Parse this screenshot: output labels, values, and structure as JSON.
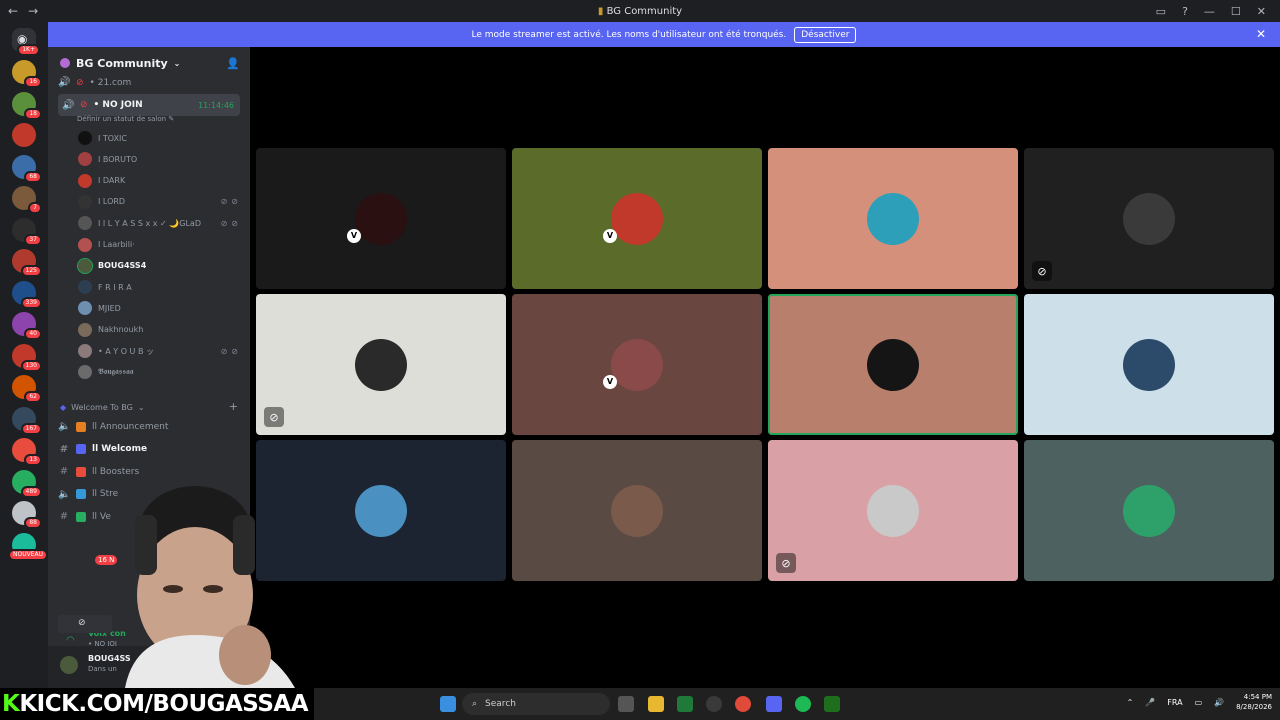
{
  "window": {
    "title": "BG Community",
    "back": "←",
    "forward": "→"
  },
  "banner": {
    "text": "Le mode streamer est activé. Les noms d'utilisateur ont été tronqués.",
    "button": "Désactiver",
    "close": "✕"
  },
  "rail": {
    "home_badge": "1K+",
    "servers": [
      {
        "badge": "16",
        "color": "#c89a2a"
      },
      {
        "badge": "18",
        "color": "#5a8f3c"
      },
      {
        "badge": "",
        "color": "#c0392b"
      },
      {
        "badge": "68",
        "color": "#3b6ea8"
      },
      {
        "badge": "7",
        "color": "#7a5a3a"
      },
      {
        "badge": "37",
        "color": "#2d2d2d"
      },
      {
        "badge": "125",
        "color": "#b03a2e"
      },
      {
        "badge": "339",
        "color": "#1f4f8a"
      },
      {
        "badge": "40",
        "color": "#8e44ad"
      },
      {
        "badge": "130",
        "color": "#c0392b"
      },
      {
        "badge": "62",
        "color": "#d35400"
      },
      {
        "badge": "167",
        "color": "#34495e"
      },
      {
        "badge": "13",
        "color": "#e74c3c"
      },
      {
        "badge": "489",
        "color": "#27ae60"
      },
      {
        "badge": "88",
        "color": "#bdc3c7"
      },
      {
        "badge": "NOUVEAU",
        "color": "#1abc9c"
      }
    ]
  },
  "sidebar": {
    "server_name": "BG Community",
    "channels_top": [
      {
        "name": "• 21.com"
      },
      {
        "name": "• NO JOIN",
        "time": "11:14:46",
        "subtitle": "Définir un statut de salon ✎"
      }
    ],
    "users": [
      {
        "name": "I TOXIC",
        "color": "#111111",
        "icons": ""
      },
      {
        "name": "I BORUTO",
        "color": "#a04040",
        "icons": ""
      },
      {
        "name": "I DARK",
        "color": "#c0392b",
        "icons": ""
      },
      {
        "name": "I LORD",
        "color": "#333333",
        "icons": "⊘⊘"
      },
      {
        "name": "I I L Y A S S x x ✓ 🌙GLaD",
        "color": "#555555",
        "icons": "⊘⊘"
      },
      {
        "name": "I Laarbili·",
        "color": "#b35050",
        "icons": ""
      },
      {
        "name": "BOUG4SS4",
        "color": "#4a5a3a",
        "icons": "",
        "me": true
      },
      {
        "name": "F R I R A",
        "color": "#2c3e50",
        "icons": ""
      },
      {
        "name": "MJIED",
        "color": "#6d8fb0",
        "icons": ""
      },
      {
        "name": "Nakhnoukh",
        "color": "#7a6a5a",
        "icons": ""
      },
      {
        "name": "• A Y O U B ッ",
        "color": "#8a7a7a",
        "icons": "⊘⊘"
      },
      {
        "name": "𝕭𝖔𝖚𝖌𝖆𝖘𝖘𝖆𝖆",
        "color": "#6b6b6b",
        "icons": ""
      }
    ],
    "category": "Welcome To BG",
    "text_channels": [
      {
        "icon": "🔈",
        "name": "ll Announcement"
      },
      {
        "icon": "#",
        "name": "ll Welcome",
        "active": true
      },
      {
        "icon": "#",
        "name": "ll Boosters"
      },
      {
        "icon": "🔈",
        "name": "ll Stre"
      },
      {
        "icon": "#",
        "name": "ll Ve"
      }
    ],
    "voice_status": {
      "title": "Voix con",
      "sub": "• NO JOI"
    },
    "user": {
      "name": "BOUG4SS",
      "status": "Dans un"
    }
  },
  "tiles": [
    {
      "bg": "#1a1a1a",
      "avatar": "#2a1010",
      "verified": true,
      "muted": false
    },
    {
      "bg": "#5b6b2a",
      "avatar": "#c0392b",
      "verified": true,
      "muted": false
    },
    {
      "bg": "#d4907a",
      "avatar": "#2e9fb8",
      "verified": false,
      "muted": false
    },
    {
      "bg": "#202020",
      "avatar": "#3a3a3a",
      "verified": false,
      "muted": true
    },
    {
      "bg": "#deded9",
      "avatar": "#2a2a2a",
      "verified": false,
      "muted": true
    },
    {
      "bg": "#6a4640",
      "avatar": "#8a4a4a",
      "verified": true,
      "muted": false
    },
    {
      "bg": "#b8806c",
      "avatar": "#151515",
      "verified": false,
      "muted": false,
      "speaking": true
    },
    {
      "bg": "#cde0ea",
      "avatar": "#2c4a6a",
      "verified": false,
      "muted": false
    },
    {
      "bg": "#1c2431",
      "avatar": "#4a90c0",
      "verified": false,
      "muted": false
    },
    {
      "bg": "#5a4a44",
      "avatar": "#7a5a4a",
      "verified": false,
      "muted": false
    },
    {
      "bg": "#d9a0a6",
      "avatar": "#c9c9c9",
      "verified": false,
      "muted": true
    },
    {
      "bg": "#4e6161",
      "avatar": "#2ea06a",
      "verified": false,
      "muted": false
    }
  ],
  "overlay": {
    "kick_prefix": "K",
    "kick_rest": "KICK.COM/BOUGASSAA",
    "cam_badge": "16 N"
  },
  "taskbar": {
    "search": "Search",
    "lang": "FRA",
    "time": "4:54 PM",
    "date": "8/28/2026"
  },
  "colors": {
    "blurple": "#5865f2",
    "green": "#23a55a",
    "kick": "#53fc18"
  }
}
